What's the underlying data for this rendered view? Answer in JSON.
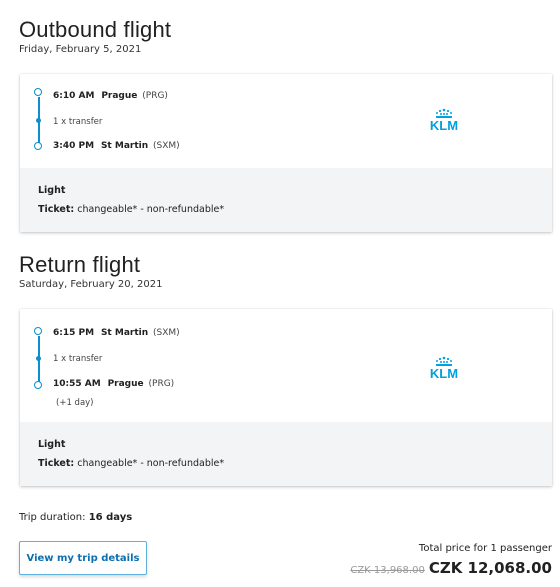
{
  "outbound": {
    "title": "Outbound flight",
    "date": "Friday, February 5, 2021",
    "departure": {
      "time": "6:10 AM",
      "city": "Prague",
      "code": "(PRG)"
    },
    "transfer": "1 x transfer",
    "arrival": {
      "time": "3:40 PM",
      "city": "St Martin",
      "code": "(SXM)"
    },
    "airline_logo": "KLM",
    "fare": "Light",
    "ticket_label": "Ticket:",
    "ticket_value": "changeable* - non-refundable*"
  },
  "return": {
    "title": "Return flight",
    "date": "Saturday, February 20, 2021",
    "departure": {
      "time": "6:15 PM",
      "city": "St Martin",
      "code": "(SXM)"
    },
    "transfer": "1 x transfer",
    "arrival": {
      "time": "10:55 AM",
      "city": "Prague",
      "code": "(PRG)",
      "day_offset": "(+1 day)"
    },
    "airline_logo": "KLM",
    "fare": "Light",
    "ticket_label": "Ticket:",
    "ticket_value": "changeable* - non-refundable*"
  },
  "trip": {
    "duration_label": "Trip duration:",
    "duration_value": "16 days",
    "details_button": "View my trip details"
  },
  "price": {
    "label": "Total price for 1 passenger",
    "old": "CZK 13,968.00",
    "new": "CZK 12,068.00"
  },
  "colors": {
    "accent": "#0b8fcf",
    "klm_blue": "#00a1de",
    "panel": "#f3f4f5"
  },
  "icons": [
    "klm-crown-logo",
    "timeline-circle-icon",
    "timeline-dot-icon"
  ]
}
